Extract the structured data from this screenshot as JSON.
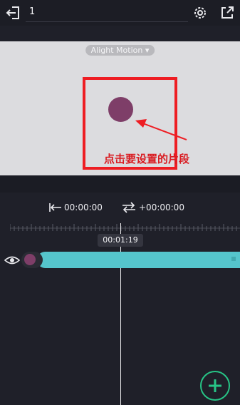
{
  "topbar": {
    "project_name": "1"
  },
  "preview": {
    "watermark": "Alight Motion ▾",
    "annotation": "点击要设置的片段"
  },
  "timeline": {
    "start_time": "00:00:00",
    "offset_time": "+00:00:00",
    "playhead_time": "00:01:19"
  },
  "colors": {
    "accent_green": "#27c486",
    "track": "#55c5cc",
    "clip": "#7e3e68",
    "annotation_red": "#ee1d23"
  },
  "icons": [
    "exit-icon",
    "settings-gear-icon",
    "export-icon",
    "go-to-start-icon",
    "loop-icon",
    "eye-icon",
    "add-icon"
  ]
}
